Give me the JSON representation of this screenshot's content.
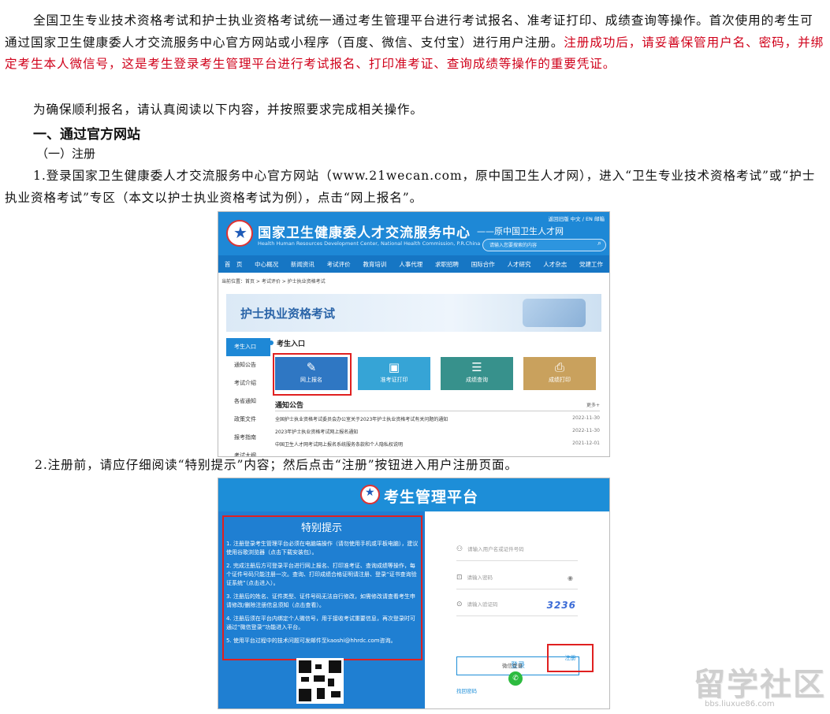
{
  "intro": {
    "line1": "全国卫生专业技术资格考试和护士执业资格考试统一通过考生管理平台进行考试报名、准考证打印、成绩查询等操作。首次使用的考生可通过国家卫生健康委人才交流服务中心官方网站或小程序（百度、微信、支付宝）进行用户注册。",
    "red": "注册成功后，请妥善保管用户名、密码，并绑定考生本人微信号，这是考生登录考生管理平台进行考试报名、打印准考证、查询成绩等操作的重要凭证。",
    "line2": "为确保顺利报名，请认真阅读以下内容，并按照要求完成相关操作。"
  },
  "section1": "一、通过官方网站",
  "sub1": "（一）注册",
  "step1": "1.登录国家卫生健康委人才交流服务中心官方网站（www.21wecan.com，原中国卫生人才网），进入“卫生专业技术资格考试”或“护士执业资格考试”专区（本文以护士执业资格考试为例），点击“网上报名”。",
  "step2": "2.注册前，请应仔细阅读“特别提示”内容；然后点击“注册”按钮进入用户注册页面。",
  "shot1": {
    "title": "国家卫生健康委人才交流服务中心",
    "title_en": "Health Human Resources Development Center, National Health Commission, P.R.China",
    "old_name": "——原中国卫生人才网",
    "top_links": "返回旧版  中文 / EN  邮箱",
    "search_placeholder": "请输入您要搜索的内容",
    "nav": [
      "首　页",
      "中心概况",
      "新闻资讯",
      "考试评价",
      "教育培训",
      "人事代理",
      "求职招聘",
      "国际合作",
      "人才研究",
      "人才杂志",
      "党建工作"
    ],
    "breadcrumb": "当前位置：首页 > 考试评价 > 护士执业资格考试",
    "banner": "护士执业资格考试",
    "side": [
      "考生入口",
      "通知公告",
      "考试介绍",
      "各省通知",
      "政策文件",
      "报考指南",
      "考试大纲"
    ],
    "entrance": "考生入口",
    "tiles": [
      {
        "label": "网上报名",
        "icon": "✎"
      },
      {
        "label": "准考证打印",
        "icon": "▣"
      },
      {
        "label": "成绩查询",
        "icon": "☰"
      },
      {
        "label": "成绩打印",
        "icon": "⎙"
      }
    ],
    "notice_title": "通知公告",
    "more": "更多+",
    "notices": [
      {
        "text": "全国护士执业资格考试委员会办公室关于2023年护士执业资格考试有关问题的通知",
        "date": "2022-11-30"
      },
      {
        "text": "2023年护士执业资格考试网上报名通知",
        "date": "2022-11-30"
      },
      {
        "text": "中国卫生人才网考试网上报名系统服务条款和个人隐私权说明",
        "date": "2021-12-01"
      }
    ]
  },
  "shot2": {
    "title": "考生管理平台",
    "tips_title": "特别提示",
    "tips": [
      "1. 注册登录考生管理平台必须在电脑端操作（请勿使用手机或平板电脑），建议使用谷歌浏览器（点击下载安装包）。",
      "2. 完成注册后方可登录平台进行网上报名、打印准考证、查询成绩等操作，每个证件号码只能注册一次。查询、打印成绩合格证明请注册、登录“证书查询验证系统”（点击进入）。",
      "3. 注册后的姓名、证件类型、证件号码无法自行修改，如需修改请查看考生申请修改/删除注册信息须知（点击查看）。",
      "4. 注册后须在平台内绑定个人微信号，用于接收考试重要信息，再次登录时可通过“微信登录”功能进入平台。",
      "5. 使用平台过程中的技术问题可发邮件至kaoshi@hhrdc.com咨询。"
    ],
    "user_placeholder": "请输入用户名或证件号码",
    "pass_placeholder": "请输入密码",
    "code_placeholder": "请输入验证码",
    "captcha": "3236",
    "login": "登录",
    "find_password": "找回密码",
    "wechat_login": "微信登录",
    "register": "注册"
  },
  "watermark": {
    "main": "留学社区",
    "url": "bbs.liuxue86.com"
  },
  "colors": {
    "accent_red": "#d0021b",
    "brand_blue": "#1e88d6"
  }
}
